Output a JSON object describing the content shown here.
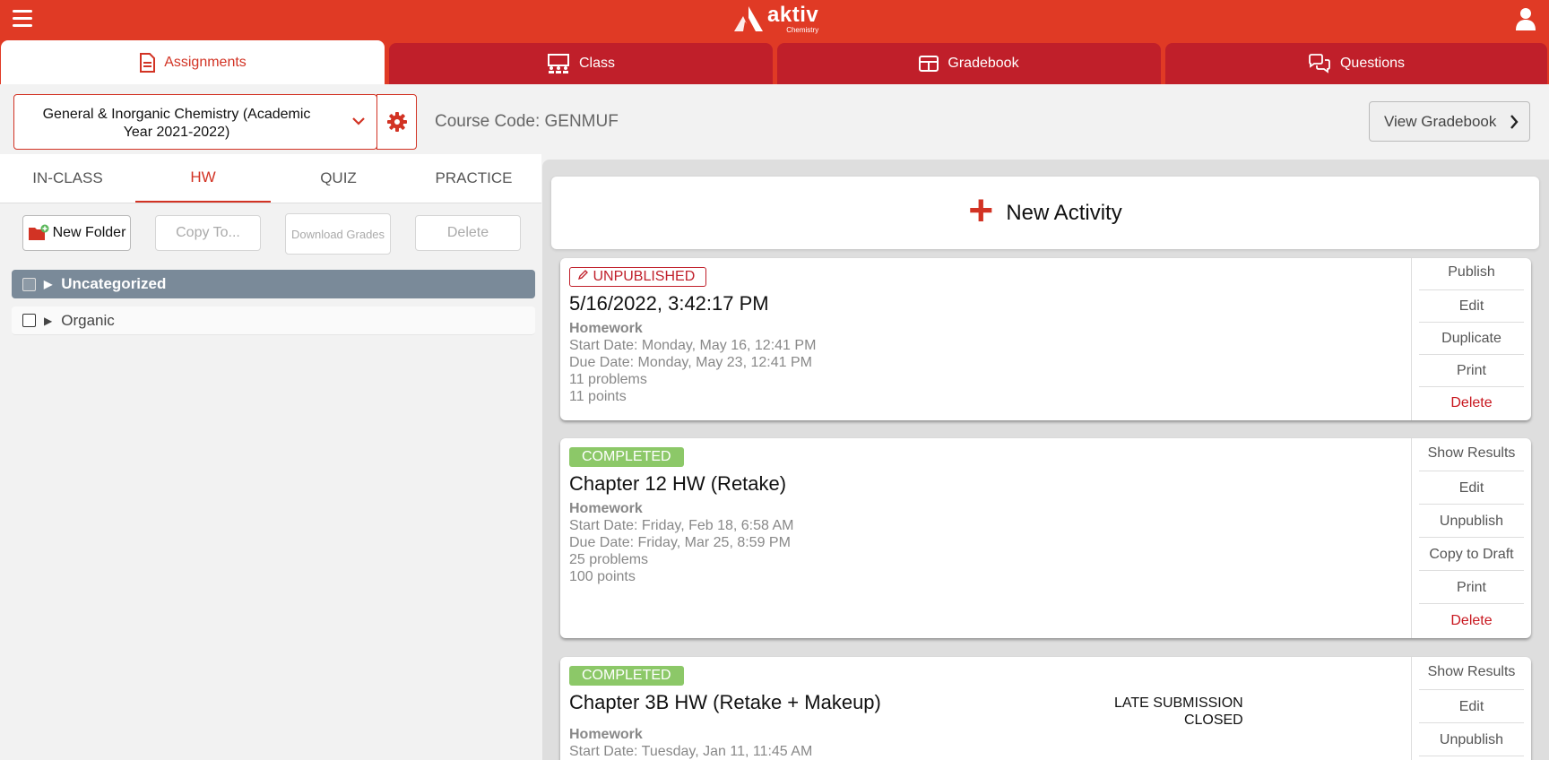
{
  "app": {
    "logo_word": "aktiv",
    "logo_sub": "Chemistry",
    "menu_icon": "hamburger-menu-icon",
    "user_icon": "user-icon"
  },
  "colors": {
    "brand": "#e03a25",
    "tab_inactive": "#c01f2a",
    "completed": "#8cc868",
    "folder_selected": "#7a8a99"
  },
  "tabs": [
    {
      "label": "Assignments",
      "icon": "assignment-icon",
      "active": true
    },
    {
      "label": "Class",
      "icon": "class-icon",
      "active": false
    },
    {
      "label": "Gradebook",
      "icon": "gradebook-icon",
      "active": false
    },
    {
      "label": "Questions",
      "icon": "questions-icon",
      "active": false
    }
  ],
  "course": {
    "name": "General & Inorganic Chemistry (Academic Year 2021-2022)",
    "code_label": "Course Code: GENMUF",
    "view_gradebook": "View Gradebook"
  },
  "subtabs": [
    {
      "label": "IN-CLASS",
      "active": false
    },
    {
      "label": "HW",
      "active": true
    },
    {
      "label": "QUIZ",
      "active": false
    },
    {
      "label": "PRACTICE",
      "active": false
    }
  ],
  "toolbar": {
    "new_folder": "New Folder",
    "copy_to": "Copy To...",
    "download_grades": "Download Grades",
    "delete": "Delete"
  },
  "folders": [
    {
      "name": "Uncategorized",
      "selected": true
    },
    {
      "name": "Organic",
      "selected": false
    }
  ],
  "new_activity": "New Activity",
  "activities": [
    {
      "status": "UNPUBLISHED",
      "title": "5/16/2022, 3:42:17 PM",
      "type": "Homework",
      "start": "Start Date: Monday, May 16, 12:41 PM",
      "due": "Due Date: Monday, May 23, 12:41 PM",
      "problems": "11 problems",
      "points": "11 points",
      "actions": [
        "Publish",
        "Edit",
        "Duplicate",
        "Print",
        "Delete"
      ]
    },
    {
      "status": "COMPLETED",
      "title": "Chapter 12 HW (Retake)",
      "type": "Homework",
      "start": "Start Date: Friday, Feb 18, 6:58 AM",
      "due": "Due Date: Friday, Mar 25, 8:59 PM",
      "problems": "25 problems",
      "points": "100 points",
      "actions": [
        "Show Results",
        "Edit",
        "Unpublish",
        "Copy to Draft",
        "Print",
        "Delete"
      ]
    },
    {
      "status": "COMPLETED",
      "title": "Chapter 3B HW (Retake + Makeup)",
      "type": "Homework",
      "start": "Start Date: Tuesday, Jan 11, 11:45 AM",
      "late_line1": "LATE SUBMISSION",
      "late_line2": "CLOSED",
      "actions": [
        "Show Results",
        "Edit",
        "Unpublish"
      ]
    }
  ]
}
